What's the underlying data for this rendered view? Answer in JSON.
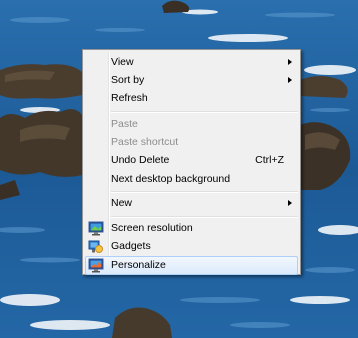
{
  "menu": {
    "group1": [
      {
        "label": "View",
        "submenu": true
      },
      {
        "label": "Sort by",
        "submenu": true
      },
      {
        "label": "Refresh"
      }
    ],
    "group2": [
      {
        "label": "Paste",
        "disabled": true
      },
      {
        "label": "Paste shortcut",
        "disabled": true
      },
      {
        "label": "Undo Delete",
        "shortcut": "Ctrl+Z"
      },
      {
        "label": "Next desktop background"
      }
    ],
    "group3": [
      {
        "label": "New",
        "submenu": true
      }
    ],
    "group4": [
      {
        "label": "Screen resolution",
        "icon": "screen-resolution-icon"
      },
      {
        "label": "Gadgets",
        "icon": "gadgets-icon"
      },
      {
        "label": "Personalize",
        "icon": "personalize-icon",
        "highlighted": true
      }
    ]
  },
  "colors": {
    "menu_bg": "#f0f0f0",
    "highlight_border": "#aecff7",
    "disabled_text": "#8d8d8d",
    "sea": "#1f5f99"
  }
}
